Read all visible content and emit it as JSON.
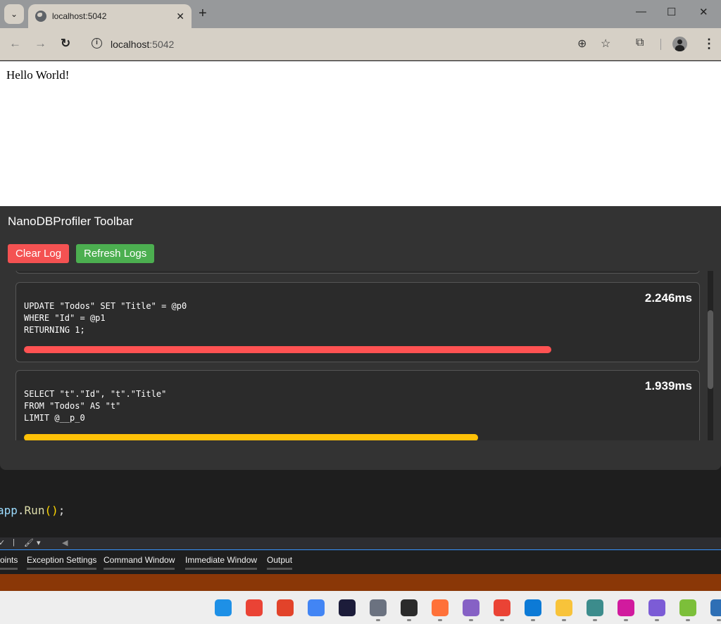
{
  "browser": {
    "tab_title": "localhost:5042",
    "url_host": "localhost",
    "url_port": ":5042",
    "icons": {
      "tab_search": "chevron-down-icon",
      "tab_favicon": "globe-icon",
      "tab_close": "close-icon",
      "new_tab": "plus-icon",
      "minimize": "minimize-icon",
      "maximize": "maximize-icon",
      "close_window": "close-icon",
      "back": "arrow-left-icon",
      "forward": "arrow-right-icon",
      "reload": "reload-icon",
      "site_info": "info-icon",
      "zoom": "zoom-icon",
      "bookmark": "star-icon",
      "extensions": "puzzle-icon",
      "profile": "avatar-icon",
      "menu": "kebab-menu-icon"
    },
    "glyphs": {
      "tab_search": "⌄",
      "tab_close": "✕",
      "new_tab": "+",
      "minimize": "—",
      "maximize": "☐",
      "close_window": "✕",
      "back": "←",
      "forward": "→",
      "reload": "↻",
      "site_info": "i",
      "zoom": "⊕",
      "bookmark": "☆",
      "extensions": "⧉",
      "menu": "⋮"
    }
  },
  "page": {
    "heading": "Hello World!"
  },
  "profiler": {
    "title": "NanoDBProfiler Toolbar",
    "buttons": {
      "clear_label": "Clear Log",
      "refresh_label": "Refresh Logs"
    },
    "colors": {
      "clear": "#f45252",
      "refresh": "#4caf50",
      "slow": "#ff5252",
      "medium": "#ffc107"
    },
    "logs": [
      {
        "duration": "2.246ms",
        "sql": "UPDATE \"Todos\" SET \"Title\" = @p0\nWHERE \"Id\" = @p1\nRETURNING 1;",
        "bar_fraction": 0.79,
        "bar_color": "#ff5252"
      },
      {
        "duration": "1.939ms",
        "sql": "SELECT \"t\".\"Id\", \"t\".\"Title\"\nFROM \"Todos\" AS \"t\"\nLIMIT @__p_0",
        "bar_fraction": 0.68,
        "bar_color": "#ffc107"
      }
    ]
  },
  "ide": {
    "code_line": {
      "ident": "app",
      "dot": ".",
      "method": "Run",
      "parens": "()",
      "semi": ";"
    },
    "toolbar_glyphs": {
      "check": "✓",
      "divider": "|",
      "brush": "🖌",
      "dropdown": "▾",
      "scroll_left": "◀"
    },
    "tabs": [
      "oints",
      "Exception Settings",
      "Command Window",
      "Immediate Window",
      "Output"
    ],
    "status_color": "#8a3707"
  },
  "taskbar": {
    "icons": [
      {
        "name": "windows-start-icon",
        "color": "#1e90e6",
        "running": false
      },
      {
        "name": "gmail-icon",
        "color": "#ea4335",
        "running": false
      },
      {
        "name": "gitlab-icon",
        "color": "#e2432a",
        "running": false
      },
      {
        "name": "google-calendar-icon",
        "color": "#4285f4",
        "running": false
      },
      {
        "name": "app-bolt-icon",
        "color": "#1c1c3a",
        "running": false
      },
      {
        "name": "settings-icon",
        "color": "#6b7280",
        "running": true
      },
      {
        "name": "terminal-icon",
        "color": "#2b2b2b",
        "running": true
      },
      {
        "name": "firefox-icon",
        "color": "#ff7139",
        "running": true
      },
      {
        "name": "visual-studio-preview-icon",
        "color": "#8661c5",
        "running": true
      },
      {
        "name": "chrome-canary-icon",
        "color": "#ea4335",
        "running": true
      },
      {
        "name": "edge-icon",
        "color": "#0c7ad6",
        "running": true
      },
      {
        "name": "file-explorer-icon",
        "color": "#f8c33a",
        "running": true
      },
      {
        "name": "dbeaver-icon",
        "color": "#3c8c8c",
        "running": true
      },
      {
        "name": "dotpeek-icon",
        "color": "#d11b9e",
        "running": true
      },
      {
        "name": "obsidian-icon",
        "color": "#7c5cd6",
        "running": true
      },
      {
        "name": "notepad-plus-icon",
        "color": "#7cbf3a",
        "running": true
      },
      {
        "name": "remote-desktop-icon",
        "color": "#2e6fb5",
        "running": true
      }
    ]
  }
}
